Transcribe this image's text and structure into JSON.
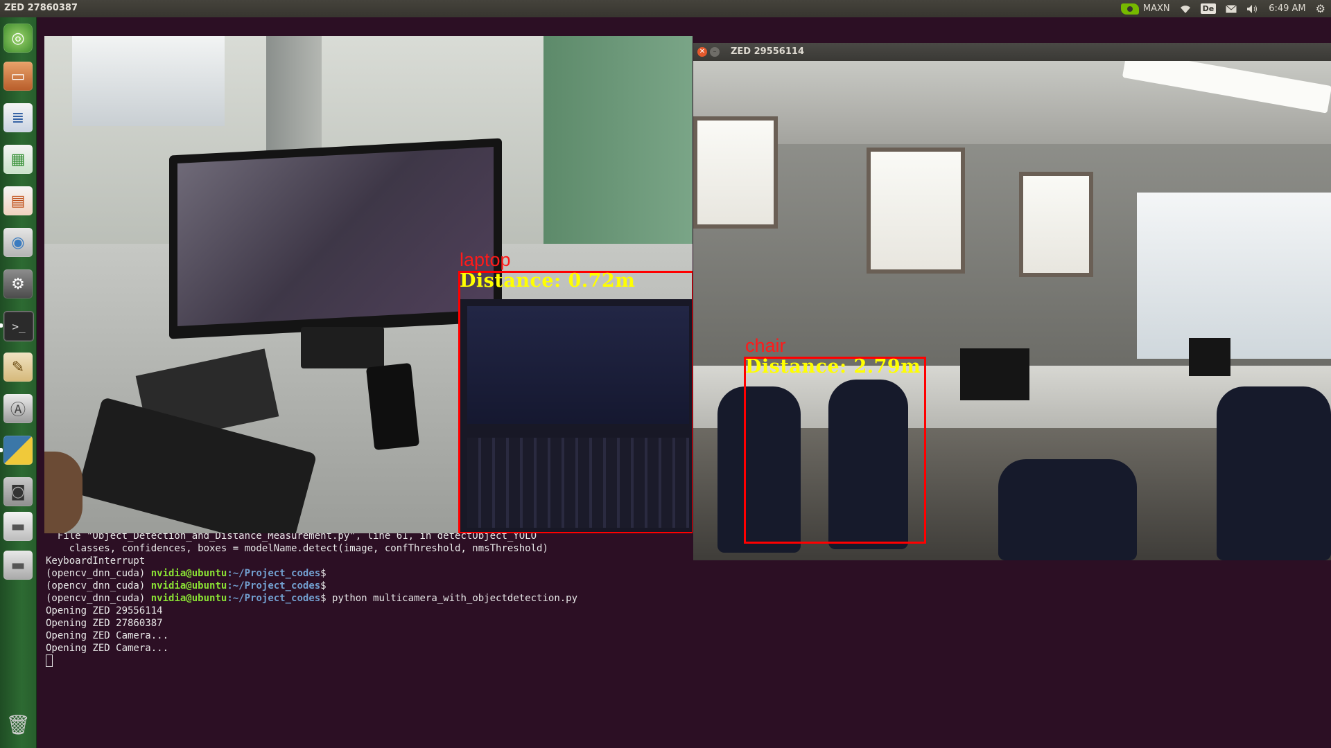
{
  "top_panel": {
    "window_title": "ZED 27860387",
    "power_mode": "MAXN",
    "keyboard_layout": "De",
    "clock": "6:49 AM",
    "icons": [
      "nvidia-icon",
      "wifi-icon",
      "keyboard-layout-icon",
      "mail-icon",
      "volume-icon",
      "gear-icon"
    ]
  },
  "launcher": {
    "items": [
      {
        "name": "ubuntu-dash",
        "icon": "ubuntu-icon"
      },
      {
        "name": "files",
        "icon": "folder-icon"
      },
      {
        "name": "libreoffice-writer",
        "icon": "writer-icon"
      },
      {
        "name": "libreoffice-calc",
        "icon": "calc-icon"
      },
      {
        "name": "libreoffice-impress",
        "icon": "impress-icon"
      },
      {
        "name": "ubuntu-software",
        "icon": "software-center-icon"
      },
      {
        "name": "system-settings",
        "icon": "settings-icon"
      },
      {
        "name": "terminal",
        "icon": "terminal-icon"
      },
      {
        "name": "text-editor",
        "icon": "text-editor-icon"
      },
      {
        "name": "software-updater",
        "icon": "updater-icon"
      },
      {
        "name": "python",
        "icon": "python-icon"
      },
      {
        "name": "camera",
        "icon": "camera-icon"
      },
      {
        "name": "drive",
        "icon": "drive-icon"
      },
      {
        "name": "drive-2",
        "icon": "drive-icon"
      },
      {
        "name": "trash",
        "icon": "trash-icon"
      }
    ]
  },
  "terminal": {
    "line1": "  File \"Object_Detection_and_Distance_Measurement.py\", line 61, in detectObject_YOLO",
    "line2": "    classes, confidences, boxes = modelName.detect(image, confThreshold, nmsThreshold)",
    "line3": "KeyboardInterrupt",
    "env": "(opencv_dnn_cuda)",
    "user": "nvidia@ubuntu",
    "path": ":~/Project_codes",
    "dollar": "$",
    "command": " python multicamera_with_objectdetection.py",
    "out1": "Opening ZED 29556114",
    "out2": "Opening ZED 27860387",
    "out3": "Opening ZED Camera...",
    "out4": "Opening ZED Camera..."
  },
  "camera_left": {
    "detection": {
      "label": "laptop",
      "distance": "Distance: 0.72m"
    }
  },
  "camera_right": {
    "window_title": "ZED 29556114",
    "detection": {
      "label": "chair",
      "distance": "Distance: 2.79m"
    }
  },
  "colors": {
    "box": "#ff0000",
    "distance_text": "#ffff00",
    "terminal_bg": "#2c0f24",
    "prompt_user": "#8ae234",
    "prompt_path": "#729fcf"
  }
}
